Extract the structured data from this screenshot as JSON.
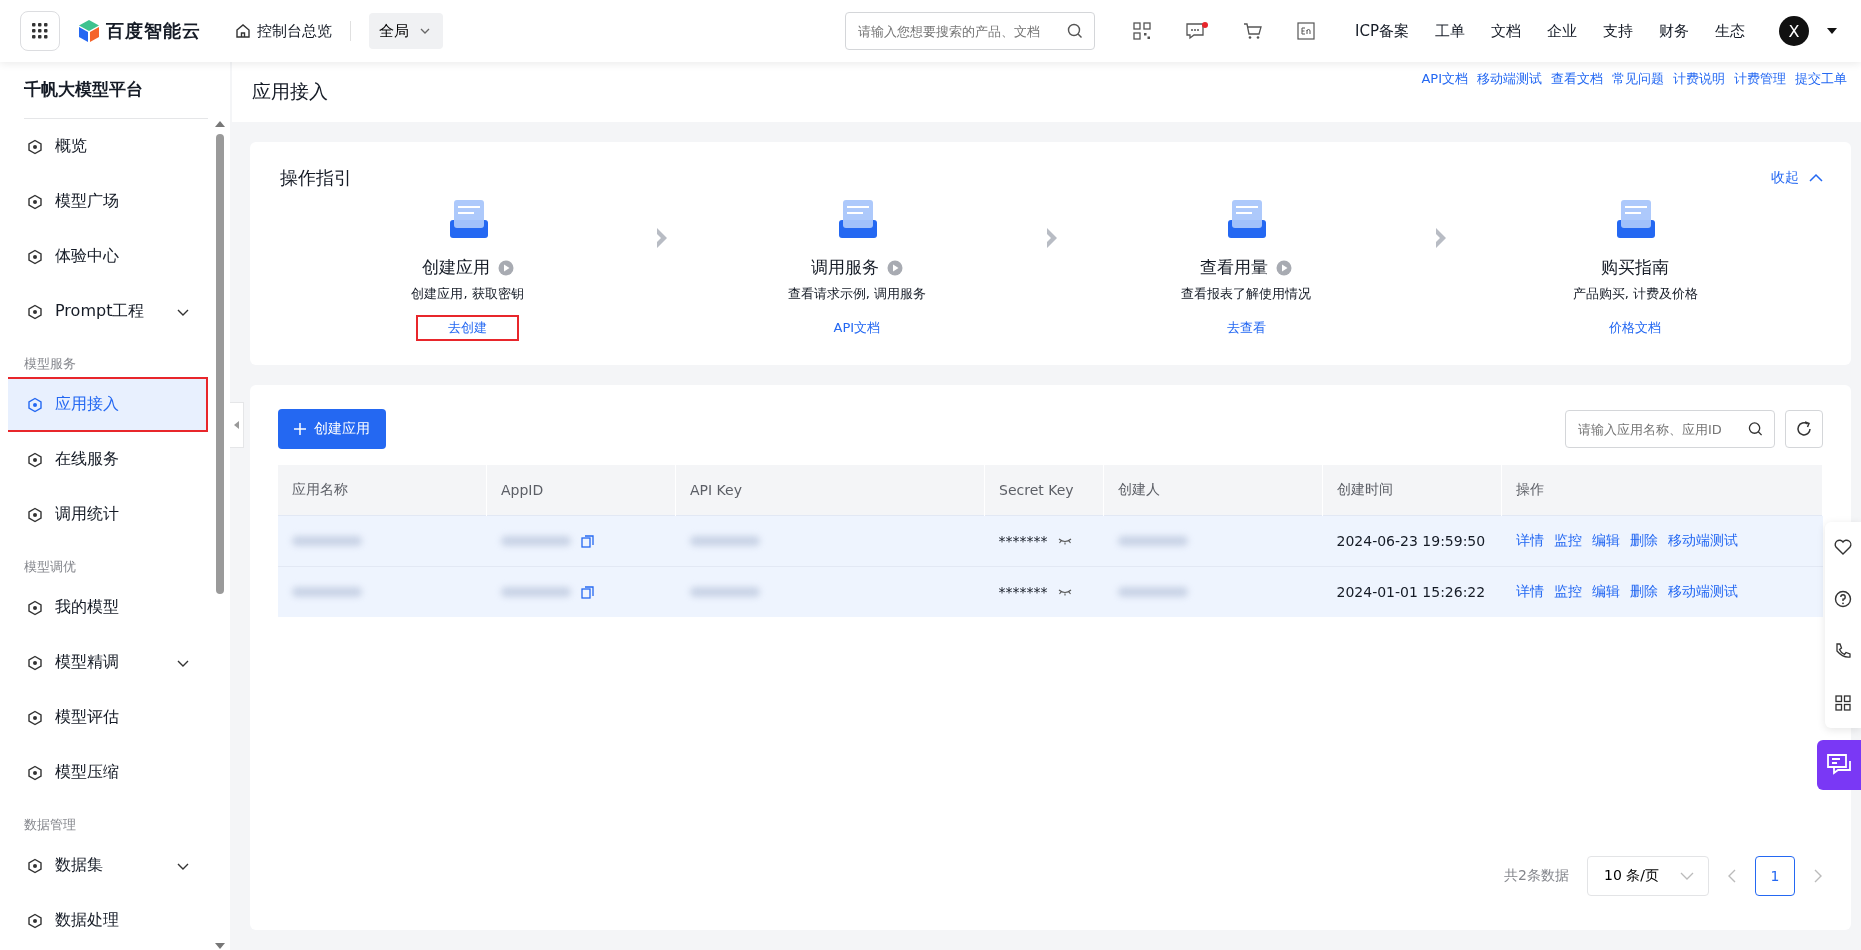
{
  "header": {
    "logo": "百度智能云",
    "console_link": "控制台总览",
    "region": "全局",
    "search_placeholder": "请输入您想要搜索的产品、文档",
    "message_unread": true,
    "nav": [
      "ICP备案",
      "工单",
      "文档",
      "企业",
      "支持",
      "财务",
      "生态"
    ],
    "avatar": "X"
  },
  "sidebar": {
    "title": "千帆大模型平台",
    "items": [
      {
        "kind": "item",
        "label": "概览",
        "selected": false,
        "expandable": false,
        "annotated": false
      },
      {
        "kind": "item",
        "label": "模型广场",
        "selected": false,
        "expandable": false,
        "annotated": false
      },
      {
        "kind": "item",
        "label": "体验中心",
        "selected": false,
        "expandable": false,
        "annotated": false
      },
      {
        "kind": "item",
        "label": "Prompt工程",
        "selected": false,
        "expandable": true,
        "annotated": false
      },
      {
        "kind": "group",
        "label": "模型服务"
      },
      {
        "kind": "item",
        "label": "应用接入",
        "selected": true,
        "expandable": false,
        "annotated": true
      },
      {
        "kind": "item",
        "label": "在线服务",
        "selected": false,
        "expandable": false,
        "annotated": false
      },
      {
        "kind": "item",
        "label": "调用统计",
        "selected": false,
        "expandable": false,
        "annotated": false
      },
      {
        "kind": "group",
        "label": "模型调优"
      },
      {
        "kind": "item",
        "label": "我的模型",
        "selected": false,
        "expandable": false,
        "annotated": false
      },
      {
        "kind": "item",
        "label": "模型精调",
        "selected": false,
        "expandable": true,
        "annotated": false
      },
      {
        "kind": "item",
        "label": "模型评估",
        "selected": false,
        "expandable": false,
        "annotated": false
      },
      {
        "kind": "item",
        "label": "模型压缩",
        "selected": false,
        "expandable": false,
        "annotated": false
      },
      {
        "kind": "group",
        "label": "数据管理"
      },
      {
        "kind": "item",
        "label": "数据集",
        "selected": false,
        "expandable": true,
        "annotated": false
      },
      {
        "kind": "item",
        "label": "数据处理",
        "selected": false,
        "expandable": false,
        "annotated": false
      }
    ]
  },
  "page": {
    "title": "应用接入",
    "links": [
      "API文档",
      "移动端测试",
      "查看文档",
      "常见问题",
      "计费说明",
      "计费管理",
      "提交工单"
    ]
  },
  "guide": {
    "title": "操作指引",
    "collapse": "收起",
    "steps": [
      {
        "title": "创建应用",
        "has_video": true,
        "desc": "创建应用, 获取密钥",
        "link": "去创建",
        "annotated": true
      },
      {
        "title": "调用服务",
        "has_video": true,
        "desc": "查看请求示例, 调用服务",
        "link": "API文档",
        "annotated": false
      },
      {
        "title": "查看用量",
        "has_video": true,
        "desc": "查看报表了解使用情况",
        "link": "去查看",
        "annotated": false
      },
      {
        "title": "购买指南",
        "has_video": false,
        "desc": "产品购买, 计费及价格",
        "link": "价格文档",
        "annotated": false
      }
    ]
  },
  "apps": {
    "create_button": "创建应用",
    "search_placeholder": "请输入应用名称、应用ID",
    "columns": [
      "应用名称",
      "AppID",
      "API Key",
      "Secret Key",
      "创建人",
      "创建时间",
      "操作"
    ],
    "rows": [
      {
        "cells": [
          {
            "kind": "redacted",
            "copyable": false
          },
          {
            "kind": "redacted",
            "copyable": true
          },
          {
            "kind": "redacted",
            "copyable": false
          },
          {
            "kind": "secret",
            "text": "*******"
          },
          {
            "kind": "redacted",
            "copyable": false
          },
          {
            "kind": "text",
            "text": "2024-06-23 19:59:50"
          },
          {
            "kind": "actions",
            "links": [
              "详情",
              "监控",
              "编辑",
              "删除",
              "移动端测试"
            ]
          }
        ]
      },
      {
        "cells": [
          {
            "kind": "redacted",
            "copyable": false
          },
          {
            "kind": "redacted",
            "copyable": true
          },
          {
            "kind": "redacted",
            "copyable": false
          },
          {
            "kind": "secret",
            "text": "*******"
          },
          {
            "kind": "redacted",
            "copyable": false
          },
          {
            "kind": "text",
            "text": "2024-01-01 15:26:22"
          },
          {
            "kind": "actions",
            "links": [
              "详情",
              "监控",
              "编辑",
              "删除",
              "移动端测试"
            ]
          }
        ]
      }
    ],
    "pagination": {
      "total": "共2条数据",
      "page_size": "10 条/页",
      "pages": [
        {
          "label": "1",
          "selected": true
        }
      ]
    }
  }
}
